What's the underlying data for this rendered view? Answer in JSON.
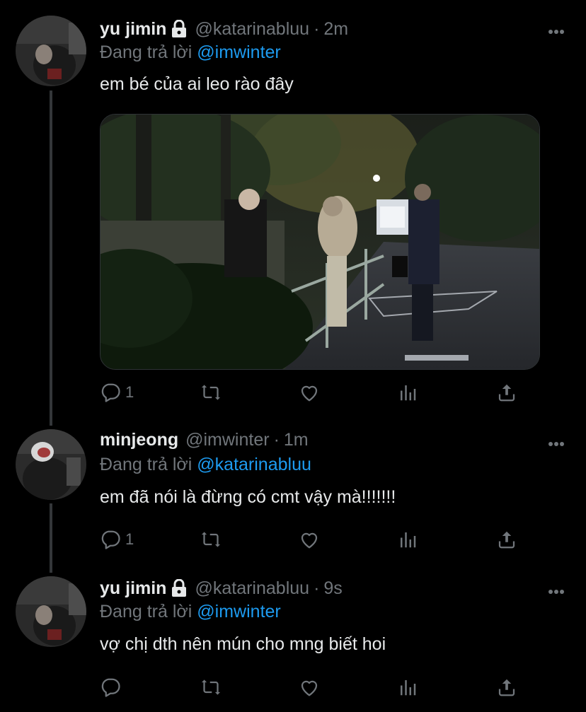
{
  "tweets": [
    {
      "name": "yu jimin",
      "handle": "@katarinabluu",
      "separator": "·",
      "time": "2m",
      "locked": true,
      "replying_prefix": "Đang trả lời",
      "replying_to": "@imwinter",
      "text": "em bé của ai leo rào đây",
      "has_media": true,
      "reply_count": "1",
      "retweet_count": "",
      "like_count": ""
    },
    {
      "name": "minjeong",
      "handle": "@imwinter",
      "separator": "·",
      "time": "1m",
      "locked": false,
      "replying_prefix": "Đang trả lời",
      "replying_to": "@katarinabluu",
      "text": "em đã nói là đừng có cmt vậy mà!!!!!!!",
      "has_media": false,
      "reply_count": "1",
      "retweet_count": "",
      "like_count": ""
    },
    {
      "name": "yu jimin",
      "handle": "@katarinabluu",
      "separator": "·",
      "time": "9s",
      "locked": true,
      "replying_prefix": "Đang trả lời",
      "replying_to": "@imwinter",
      "text": "vợ chị dth nên mún cho mng biết hoi",
      "has_media": false,
      "reply_count": "",
      "retweet_count": "",
      "like_count": ""
    }
  ],
  "icons": {
    "more": "more-horizontal-icon",
    "reply": "reply-icon",
    "retweet": "retweet-icon",
    "like": "like-icon",
    "views": "analytics-icon",
    "share": "share-icon",
    "lock": "lock-icon"
  },
  "colors": {
    "background": "#000000",
    "text": "#e7e9ea",
    "secondary": "#71767b",
    "link": "#1d9bf0",
    "thread_line": "#333639"
  }
}
